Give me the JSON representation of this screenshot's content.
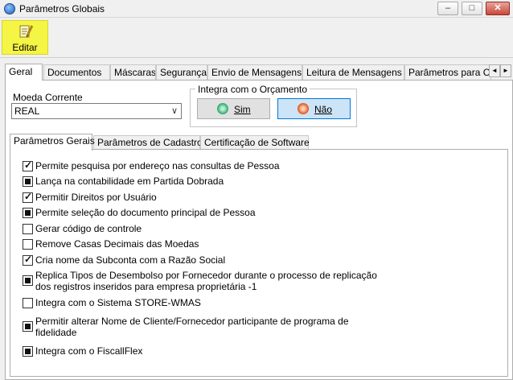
{
  "window": {
    "title": "Parâmetros Globais",
    "minimize": "–",
    "maximize": "□",
    "close": "✕"
  },
  "toolbar": {
    "editar_label": "Editar",
    "editar_icon": "edit-document-icon",
    "highlight_color": "#f5f545"
  },
  "main_tabs": [
    "Geral",
    "Documentos",
    "Máscaras",
    "Segurança",
    "Envio de Mensagens",
    "Leitura de Mensagens",
    "Parâmetros para Co"
  ],
  "main_tabs_active": "Geral",
  "tab_scroll": {
    "left": "◄",
    "right": "►"
  },
  "moeda": {
    "label": "Moeda Corrente",
    "value": "REAL",
    "arrow": "∨"
  },
  "integra": {
    "title": "Integra com o Orçamento",
    "sim": "Sim",
    "nao": "Não",
    "selected": "Não"
  },
  "sub_tabs": [
    "Parâmetros Gerais",
    "Parâmetros de Cadastro",
    "Certificação de Software"
  ],
  "sub_tabs_active": "Parâmetros Gerais",
  "checkboxes": [
    {
      "label": "Permite pesquisa por endereço nas consultas de Pessoa",
      "state": "checked"
    },
    {
      "label": "Lança na contabilidade em Partida Dobrada",
      "state": "indeterminate"
    },
    {
      "label": "Permitir Direitos por Usuário",
      "state": "checked"
    },
    {
      "label": "Permite seleção do documento principal de Pessoa",
      "state": "indeterminate"
    },
    {
      "label": "Gerar código de controle",
      "state": "unchecked"
    },
    {
      "label": "Remove Casas Decimais das Moedas",
      "state": "unchecked"
    },
    {
      "label": "Cria nome da Subconta com a Razão Social",
      "state": "checked"
    },
    {
      "label": "Replica Tipos de Desembolso por Fornecedor durante o processo de replicação dos registros inseridos para empresa proprietária -1",
      "state": "indeterminate"
    },
    {
      "label": "Integra com o Sistema STORE-WMAS",
      "state": "unchecked"
    },
    {
      "label": "Permitir alterar Nome de Cliente/Fornecedor participante de programa de fidelidade",
      "state": "indeterminate"
    },
    {
      "label": "Integra com o FiscallFlex",
      "state": "indeterminate"
    }
  ]
}
